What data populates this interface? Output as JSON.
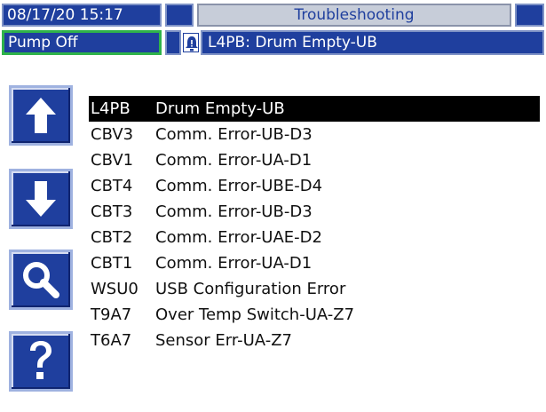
{
  "header": {
    "datetime": "08/17/20 15:17",
    "title": "Troubleshooting",
    "status": "Pump Off",
    "active_error": "L4PB: Drum Empty-UB",
    "alert_icon": "bell-alert-icon"
  },
  "colors": {
    "panel_blue": "#1f3f9e",
    "status_border_green": "#2fb34a",
    "title_tab_grey": "#c7cdd9",
    "selected_row": "#000000"
  },
  "buttons": [
    {
      "name": "scroll-up-button",
      "icon": "arrow-up-icon"
    },
    {
      "name": "scroll-down-button",
      "icon": "arrow-down-icon"
    },
    {
      "name": "search-button",
      "icon": "magnifier-icon"
    },
    {
      "name": "help-button",
      "icon": "question-icon"
    }
  ],
  "errors": [
    {
      "code": "L4PB",
      "desc": "Drum Empty-UB",
      "selected": true
    },
    {
      "code": "CBV3",
      "desc": "Comm. Error-UB-D3"
    },
    {
      "code": "CBV1",
      "desc": "Comm. Error-UA-D1"
    },
    {
      "code": "CBT4",
      "desc": "Comm. Error-UBE-D4"
    },
    {
      "code": "CBT3",
      "desc": "Comm. Error-UB-D3"
    },
    {
      "code": "CBT2",
      "desc": "Comm. Error-UAE-D2"
    },
    {
      "code": "CBT1",
      "desc": "Comm. Error-UA-D1"
    },
    {
      "code": "WSU0",
      "desc": "USB Configuration Error"
    },
    {
      "code": "T9A7",
      "desc": "Over Temp Switch-UA-Z7"
    },
    {
      "code": "T6A7",
      "desc": "Sensor Err-UA-Z7"
    }
  ]
}
